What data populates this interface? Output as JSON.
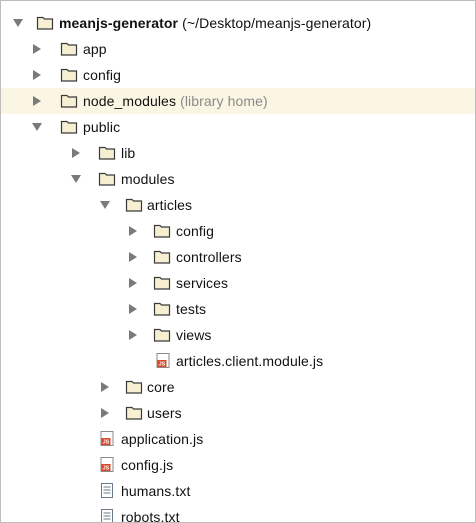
{
  "tree": {
    "root": {
      "name": "meanjs-generator",
      "path": "(~/Desktop/meanjs-generator)"
    },
    "items": [
      {
        "label": "app",
        "note": ""
      },
      {
        "label": "config",
        "note": ""
      },
      {
        "label": "node_modules",
        "note": "(library home)"
      },
      {
        "label": "public",
        "note": ""
      },
      {
        "label": "lib",
        "note": ""
      },
      {
        "label": "modules",
        "note": ""
      },
      {
        "label": "articles",
        "note": ""
      },
      {
        "label": "config",
        "note": ""
      },
      {
        "label": "controllers",
        "note": ""
      },
      {
        "label": "services",
        "note": ""
      },
      {
        "label": "tests",
        "note": ""
      },
      {
        "label": "views",
        "note": ""
      },
      {
        "label": "articles.client.module.js",
        "note": ""
      },
      {
        "label": "core",
        "note": ""
      },
      {
        "label": "users",
        "note": ""
      },
      {
        "label": "application.js",
        "note": ""
      },
      {
        "label": "config.js",
        "note": ""
      },
      {
        "label": "humans.txt",
        "note": ""
      },
      {
        "label": "robots.txt",
        "note": ""
      }
    ]
  },
  "icons": {
    "folder": "folder-icon",
    "js_file": "js-file-icon",
    "text_file": "text-file-icon",
    "expanded": "disclosure-down-icon",
    "collapsed": "disclosure-right-icon"
  },
  "colors": {
    "highlight_row": "#fbf6e3",
    "muted_text": "#8a8a8a",
    "folder_fill": "#f6efd2",
    "folder_stroke": "#3a3a3a",
    "js_badge": "#d9482b"
  }
}
